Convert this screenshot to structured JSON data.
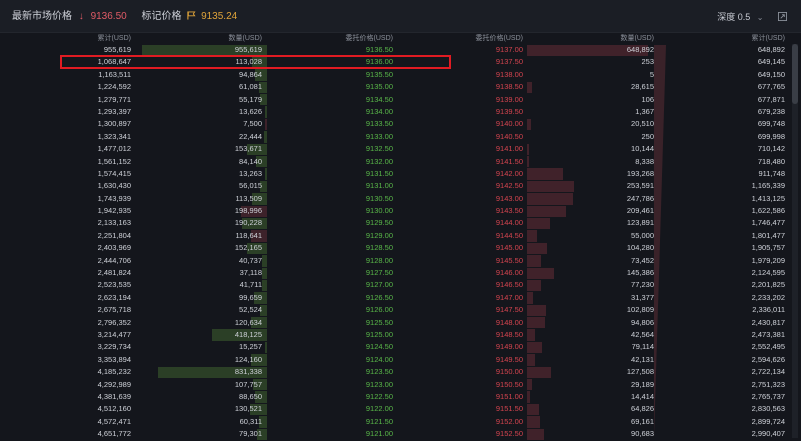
{
  "header": {
    "market_label": "最新市场价格",
    "market_price": "9136.50",
    "mark_label": "标记价格",
    "mark_price": "9135.24",
    "depth_label": "深度 0.5",
    "colors": {
      "down": "#e15b66",
      "mark": "#e0a43a",
      "bid": "#59b749",
      "ask": "#d4444f"
    }
  },
  "columns": [
    "累计(USD)",
    "数量(USD)",
    "委托价格(USD)",
    "委托价格(USD)",
    "数量(USD)",
    "累计(USD)"
  ],
  "rows": [
    {
      "bid_cum": "955,619",
      "bid_qty": "955,619",
      "bid_price": "9136.50",
      "ask_price": "9137.00",
      "ask_qty": "648,892",
      "ask_cum": "648,892"
    },
    {
      "bid_cum": "1,068,647",
      "bid_qty": "113,028",
      "bid_price": "9136.00",
      "ask_price": "9137.50",
      "ask_qty": "253",
      "ask_cum": "649,145"
    },
    {
      "bid_cum": "1,163,511",
      "bid_qty": "94,864",
      "bid_price": "9135.50",
      "ask_price": "9138.00",
      "ask_qty": "5",
      "ask_cum": "649,150"
    },
    {
      "bid_cum": "1,224,592",
      "bid_qty": "61,081",
      "bid_price": "9135.00",
      "ask_price": "9138.50",
      "ask_qty": "28,615",
      "ask_cum": "677,765"
    },
    {
      "bid_cum": "1,279,771",
      "bid_qty": "55,179",
      "bid_price": "9134.50",
      "ask_price": "9139.00",
      "ask_qty": "106",
      "ask_cum": "677,871"
    },
    {
      "bid_cum": "1,293,397",
      "bid_qty": "13,626",
      "bid_price": "9134.00",
      "ask_price": "9139.50",
      "ask_qty": "1,367",
      "ask_cum": "679,238"
    },
    {
      "bid_cum": "1,300,897",
      "bid_qty": "7,500",
      "bid_price": "9133.50",
      "ask_price": "9140.00",
      "ask_qty": "20,510",
      "ask_cum": "699,748"
    },
    {
      "bid_cum": "1,323,341",
      "bid_qty": "22,444",
      "bid_price": "9133.00",
      "ask_price": "9140.50",
      "ask_qty": "250",
      "ask_cum": "699,998"
    },
    {
      "bid_cum": "1,477,012",
      "bid_qty": "153,671",
      "bid_price": "9132.50",
      "ask_price": "9141.00",
      "ask_qty": "10,144",
      "ask_cum": "710,142"
    },
    {
      "bid_cum": "1,561,152",
      "bid_qty": "84,140",
      "bid_price": "9132.00",
      "ask_price": "9141.50",
      "ask_qty": "8,338",
      "ask_cum": "718,480"
    },
    {
      "bid_cum": "1,574,415",
      "bid_qty": "13,263",
      "bid_price": "9131.50",
      "ask_price": "9142.00",
      "ask_qty": "193,268",
      "ask_cum": "911,748"
    },
    {
      "bid_cum": "1,630,430",
      "bid_qty": "56,015",
      "bid_price": "9131.00",
      "ask_price": "9142.50",
      "ask_qty": "253,591",
      "ask_cum": "1,165,339"
    },
    {
      "bid_cum": "1,743,939",
      "bid_qty": "113,509",
      "bid_price": "9130.50",
      "ask_price": "9143.00",
      "ask_qty": "247,786",
      "ask_cum": "1,413,125"
    },
    {
      "bid_cum": "1,942,935",
      "bid_qty": "198,996",
      "bid_price": "9130.00",
      "ask_price": "9143.50",
      "ask_qty": "209,461",
      "ask_cum": "1,622,586"
    },
    {
      "bid_cum": "2,133,163",
      "bid_qty": "190,228",
      "bid_price": "9129.50",
      "ask_price": "9144.00",
      "ask_qty": "123,891",
      "ask_cum": "1,746,477"
    },
    {
      "bid_cum": "2,251,804",
      "bid_qty": "118,641",
      "bid_price": "9129.00",
      "ask_price": "9144.50",
      "ask_qty": "55,000",
      "ask_cum": "1,801,477"
    },
    {
      "bid_cum": "2,403,969",
      "bid_qty": "152,165",
      "bid_price": "9128.50",
      "ask_price": "9145.00",
      "ask_qty": "104,280",
      "ask_cum": "1,905,757"
    },
    {
      "bid_cum": "2,444,706",
      "bid_qty": "40,737",
      "bid_price": "9128.00",
      "ask_price": "9145.50",
      "ask_qty": "73,452",
      "ask_cum": "1,979,209"
    },
    {
      "bid_cum": "2,481,824",
      "bid_qty": "37,118",
      "bid_price": "9127.50",
      "ask_price": "9146.00",
      "ask_qty": "145,386",
      "ask_cum": "2,124,595"
    },
    {
      "bid_cum": "2,523,535",
      "bid_qty": "41,711",
      "bid_price": "9127.00",
      "ask_price": "9146.50",
      "ask_qty": "77,230",
      "ask_cum": "2,201,825"
    },
    {
      "bid_cum": "2,623,194",
      "bid_qty": "99,659",
      "bid_price": "9126.50",
      "ask_price": "9147.00",
      "ask_qty": "31,377",
      "ask_cum": "2,233,202"
    },
    {
      "bid_cum": "2,675,718",
      "bid_qty": "52,524",
      "bid_price": "9126.00",
      "ask_price": "9147.50",
      "ask_qty": "102,809",
      "ask_cum": "2,336,011"
    },
    {
      "bid_cum": "2,796,352",
      "bid_qty": "120,634",
      "bid_price": "9125.50",
      "ask_price": "9148.00",
      "ask_qty": "94,806",
      "ask_cum": "2,430,817"
    },
    {
      "bid_cum": "3,214,477",
      "bid_qty": "418,125",
      "bid_price": "9125.00",
      "ask_price": "9148.50",
      "ask_qty": "42,564",
      "ask_cum": "2,473,381"
    },
    {
      "bid_cum": "3,229,734",
      "bid_qty": "15,257",
      "bid_price": "9124.50",
      "ask_price": "9149.00",
      "ask_qty": "79,114",
      "ask_cum": "2,552,495"
    },
    {
      "bid_cum": "3,353,894",
      "bid_qty": "124,160",
      "bid_price": "9124.00",
      "ask_price": "9149.50",
      "ask_qty": "42,131",
      "ask_cum": "2,594,626"
    },
    {
      "bid_cum": "4,185,232",
      "bid_qty": "831,338",
      "bid_price": "9123.50",
      "ask_price": "9150.00",
      "ask_qty": "127,508",
      "ask_cum": "2,722,134"
    },
    {
      "bid_cum": "4,292,989",
      "bid_qty": "107,757",
      "bid_price": "9123.00",
      "ask_price": "9150.50",
      "ask_qty": "29,189",
      "ask_cum": "2,751,323"
    },
    {
      "bid_cum": "4,381,639",
      "bid_qty": "88,650",
      "bid_price": "9122.50",
      "ask_price": "9151.00",
      "ask_qty": "14,414",
      "ask_cum": "2,765,737"
    },
    {
      "bid_cum": "4,512,160",
      "bid_qty": "130,521",
      "bid_price": "9122.00",
      "ask_price": "9151.50",
      "ask_qty": "64,826",
      "ask_cum": "2,830,563"
    },
    {
      "bid_cum": "4,572,471",
      "bid_qty": "60,311",
      "bid_price": "9121.50",
      "ask_price": "9152.00",
      "ask_qty": "69,161",
      "ask_cum": "2,899,724"
    },
    {
      "bid_cum": "4,651,772",
      "bid_qty": "79,301",
      "bid_price": "9121.00",
      "ask_price": "9152.50",
      "ask_qty": "90,683",
      "ask_cum": "2,990,407"
    }
  ]
}
